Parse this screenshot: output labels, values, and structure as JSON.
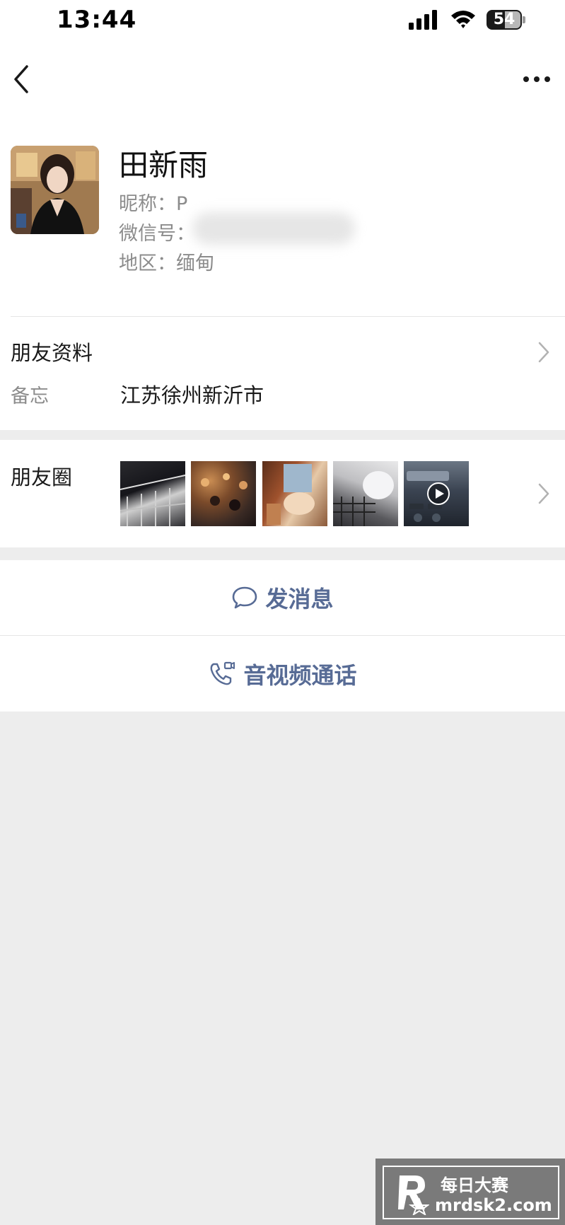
{
  "status_bar": {
    "time": "13:44",
    "battery": "54"
  },
  "nav": {
    "back_icon": "chevron-left-icon",
    "more_icon": "more-dots-icon"
  },
  "profile": {
    "name": "田新雨",
    "nickname_line": "昵称：P",
    "wechat_id_line": "微信号：",
    "region_line": "地区：缅甸"
  },
  "friend_info": {
    "title": "朋友资料",
    "remark_label": "备忘",
    "remark_value": "江苏徐州新沂市"
  },
  "moments": {
    "title": "朋友圈",
    "thumbnails": 5,
    "video_on_thumbnail": 5
  },
  "actions": {
    "send_message": "发消息",
    "av_call": "音视频通话"
  },
  "watermark": {
    "line1": "每日大赛",
    "line2": "mrdsk2.com"
  },
  "colors": {
    "link_blue": "#576b95",
    "background": "#ededed",
    "secondary_text": "#8c8c8c"
  }
}
